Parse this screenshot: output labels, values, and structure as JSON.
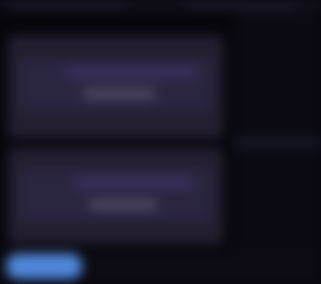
{
  "window": {
    "title": ""
  },
  "cards": [
    {
      "title": "",
      "subtitle": "",
      "action": ""
    },
    {
      "title": "",
      "subtitle": "",
      "action": ""
    }
  ],
  "footer": {
    "primary_button": ""
  },
  "colors": {
    "background": "#07060c",
    "card": "#231f30",
    "card_inner": "#2a2540",
    "accent_row": "#3b2f5c",
    "primary": "#4f86d9"
  }
}
